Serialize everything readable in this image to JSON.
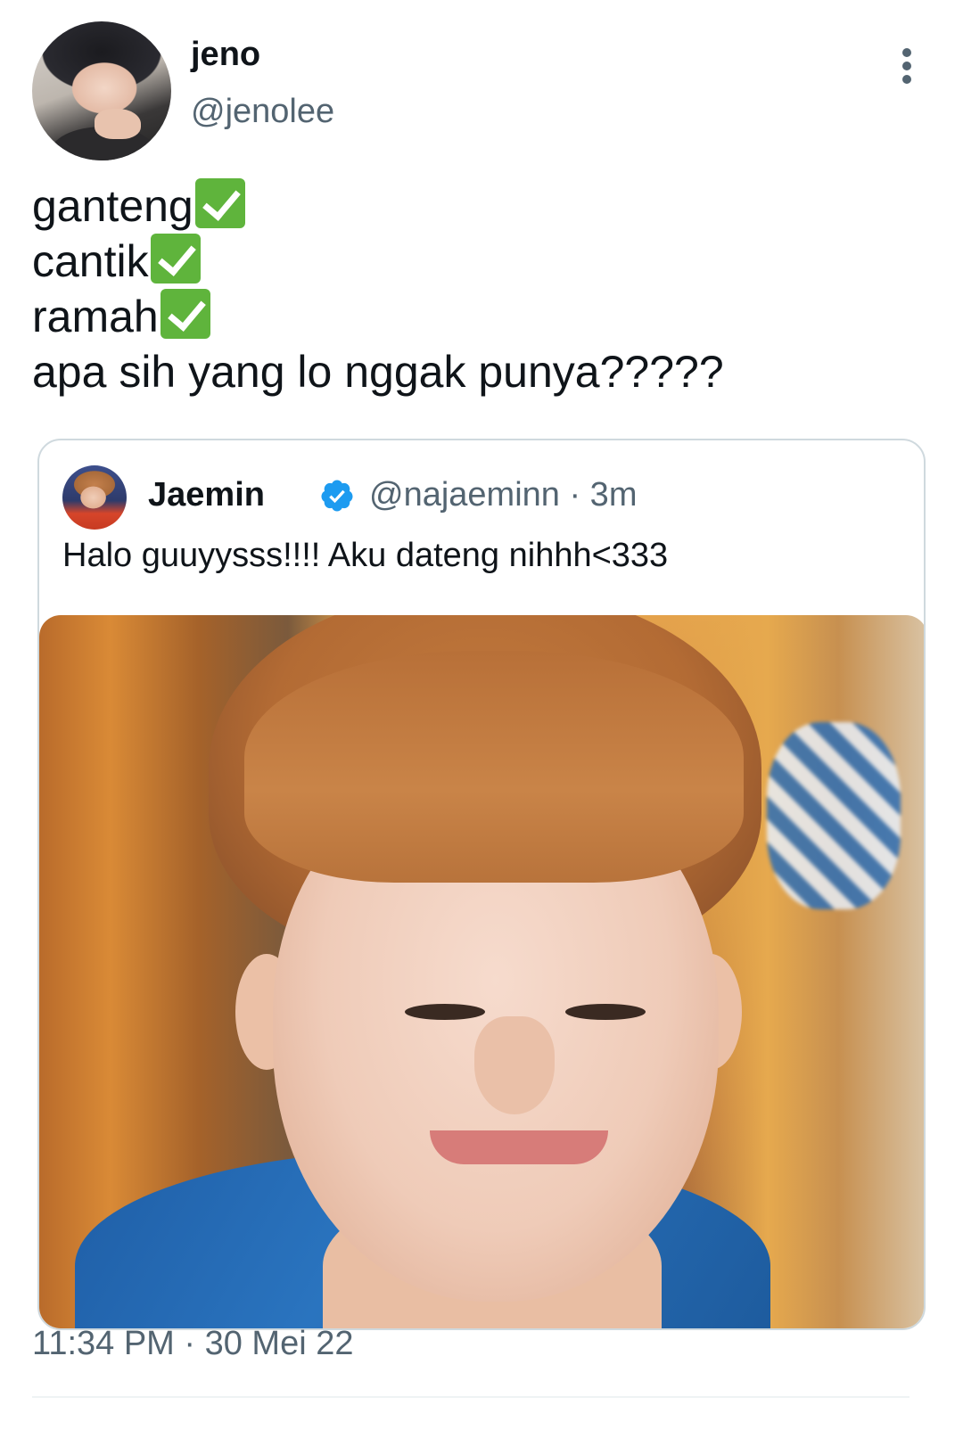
{
  "author": {
    "name": "jeno",
    "handle": "@jenolee"
  },
  "tweet": {
    "lines": [
      {
        "text": "ganteng",
        "emoji": "check-mark-button"
      },
      {
        "text": "cantik",
        "emoji": "check-mark-button"
      },
      {
        "text": "ramah",
        "emoji": "check-mark-button"
      },
      {
        "text": "apa sih yang lo nggak punya?????"
      }
    ]
  },
  "quote": {
    "name": "Jaemin",
    "handle_time": "@najaeminn · 3m",
    "text": "Halo guuyysss!!!! Aku dateng nihhh<333",
    "verified": true
  },
  "timestamp": "11:34 PM · 30 Mei 22",
  "colors": {
    "text": "#0f1419",
    "secondary": "#536471",
    "verified": "#1d9bf0",
    "check_emoji": "#5fb43c",
    "border": "#cfd9de"
  }
}
